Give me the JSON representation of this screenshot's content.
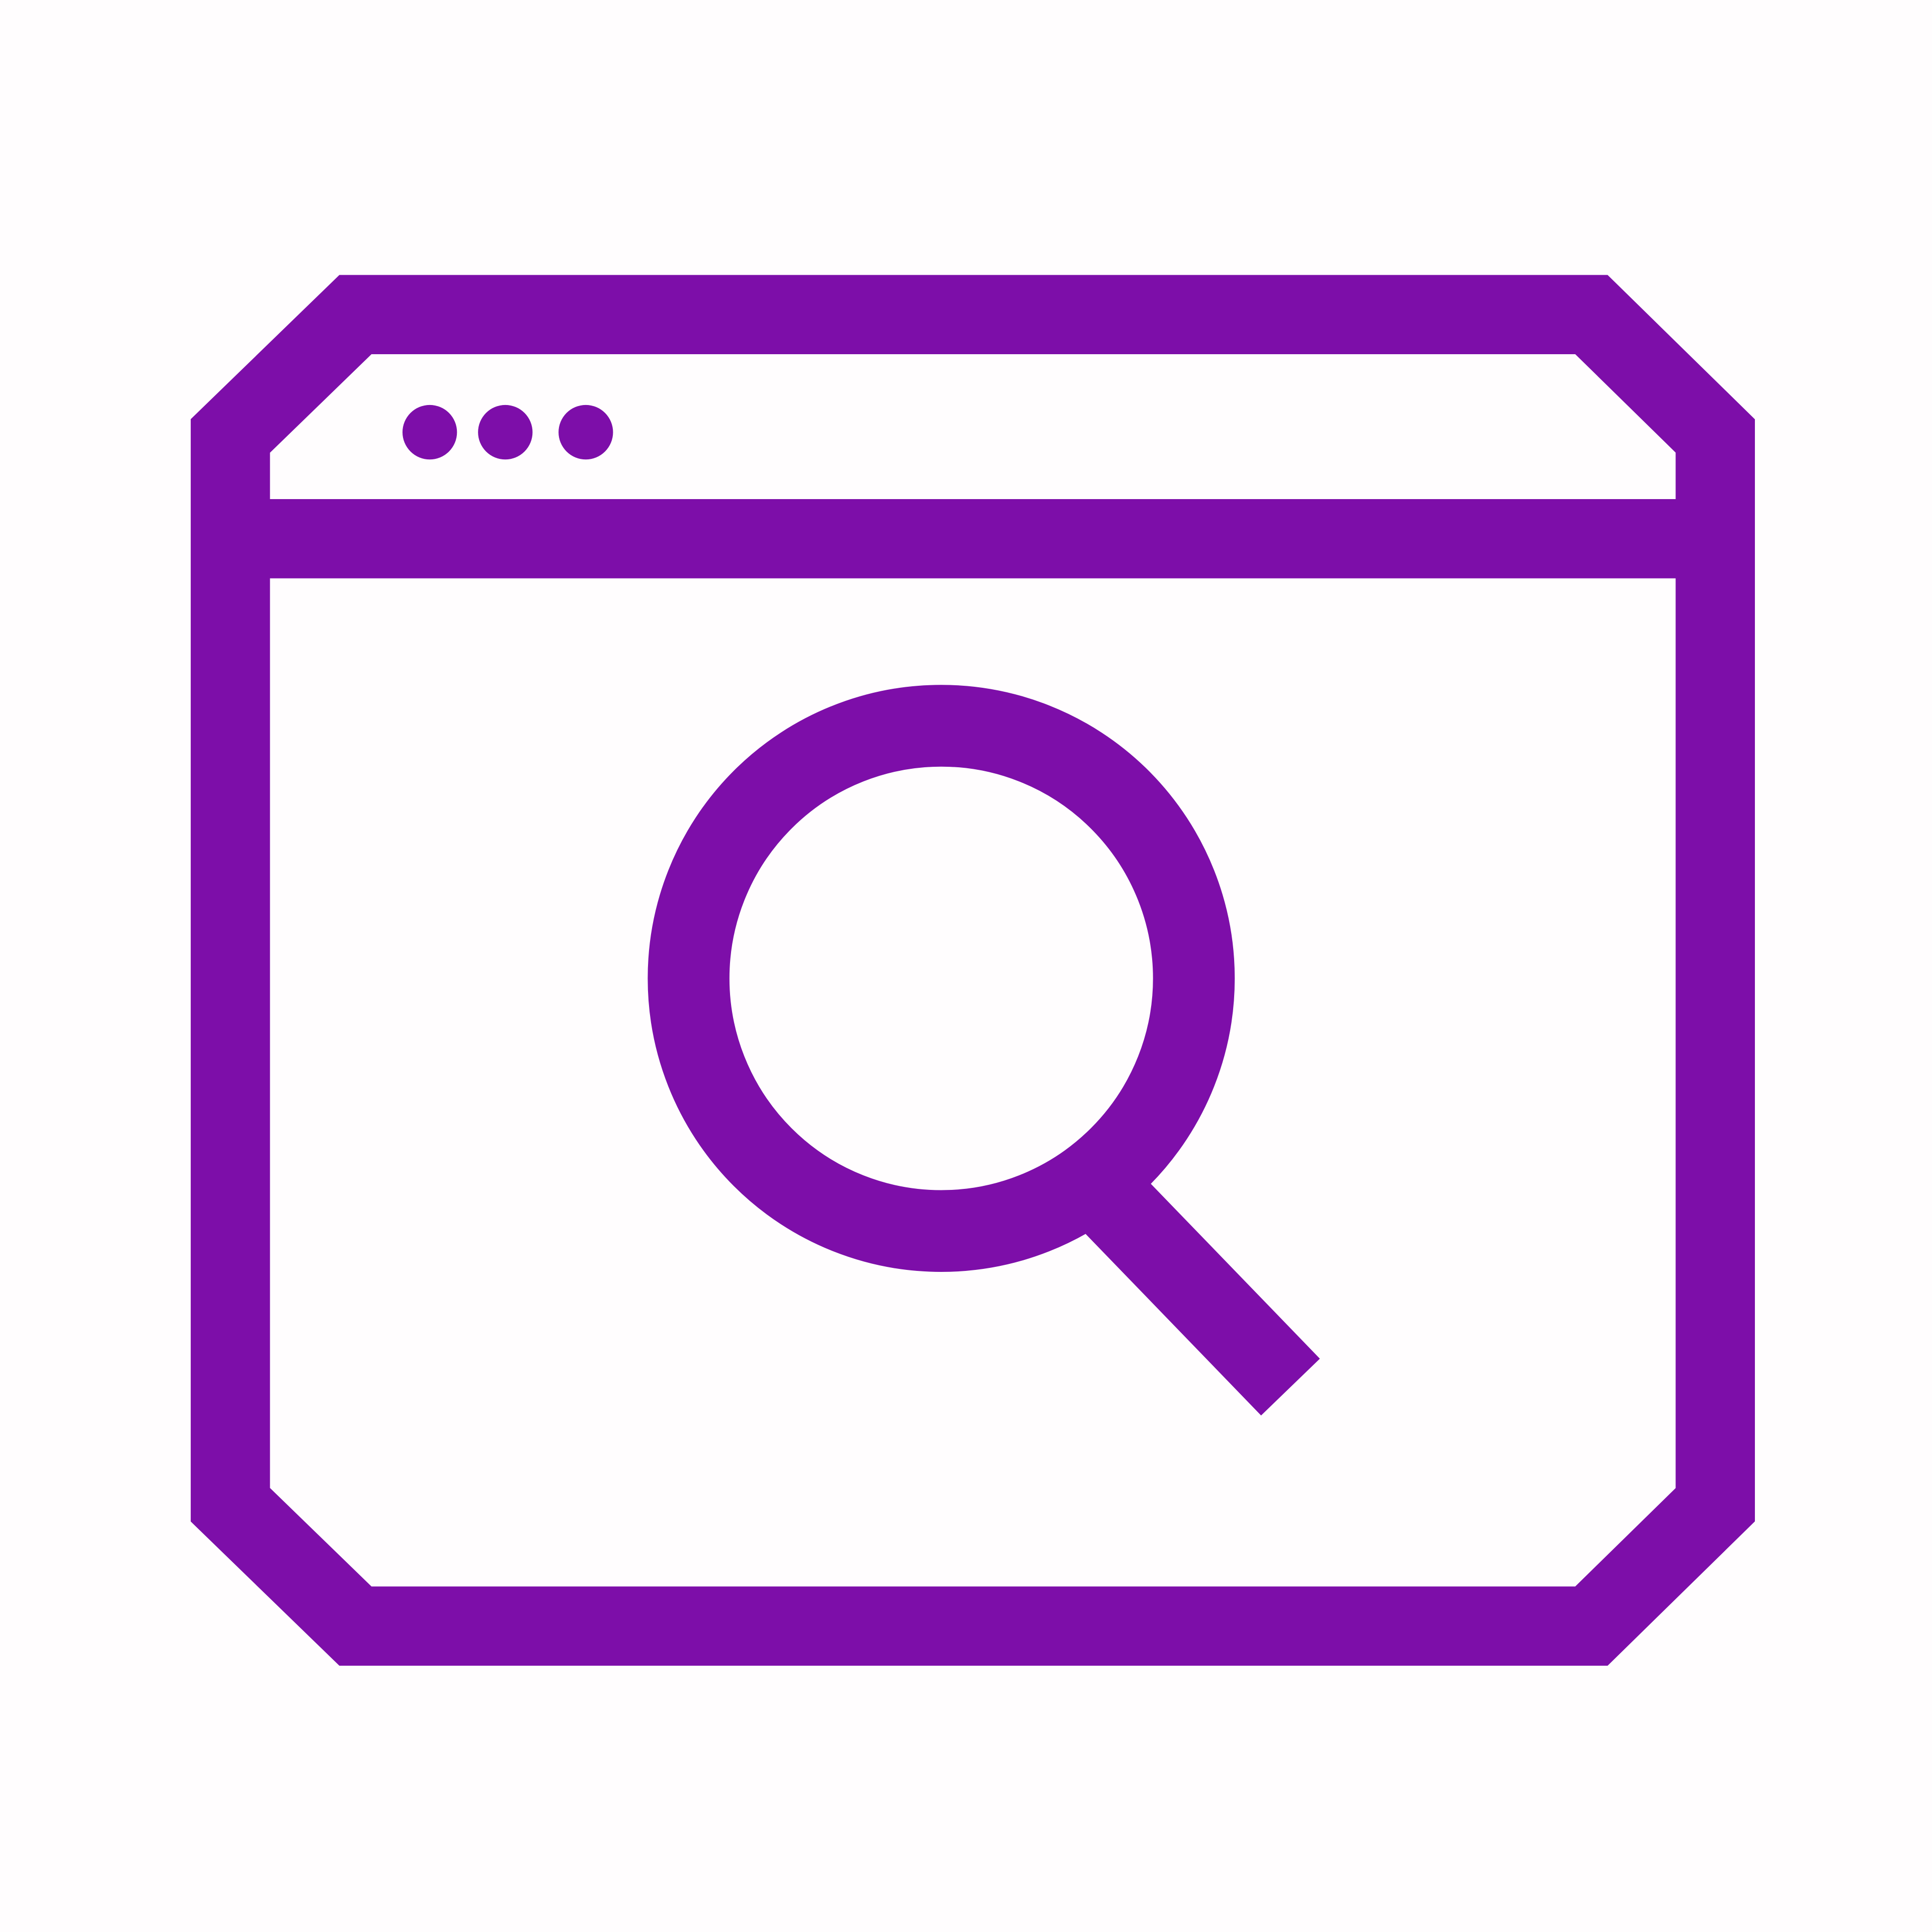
{
  "icon": {
    "name": "browser-search-icon",
    "parts": {
      "window": "browser-window-icon",
      "dots": "window-dots-icon",
      "magnifier": "magnifying-glass-icon"
    },
    "colors": {
      "stroke": "#7d0ea9",
      "background": "#fffdfe"
    }
  }
}
